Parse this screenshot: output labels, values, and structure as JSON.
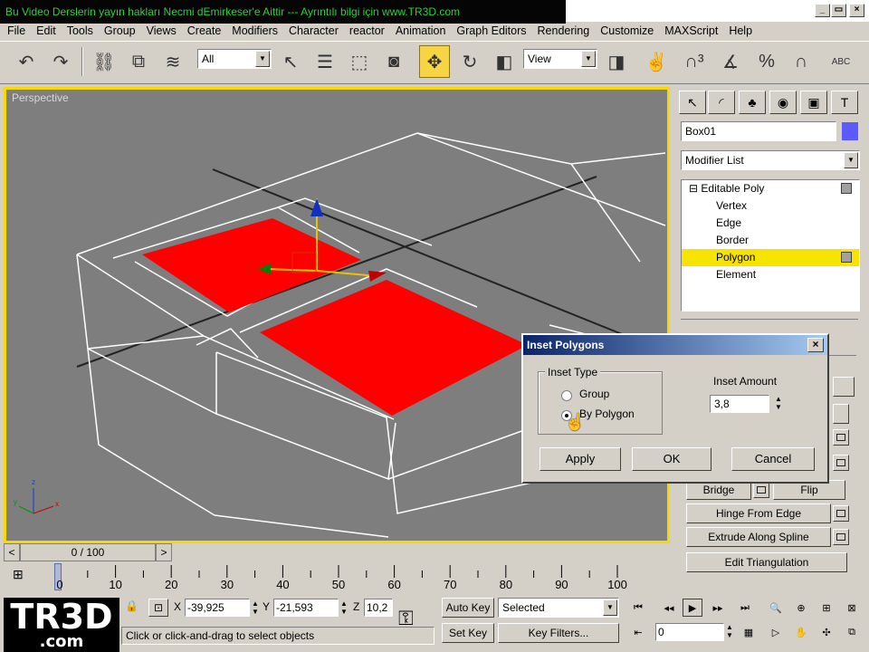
{
  "title_bar": {
    "text": "Bu Video Derslerin yayın hakları Necmi dEmirkeser'e Aittir --- Ayrıntılı bilgi için www.TR3D.com"
  },
  "menu": [
    "File",
    "Edit",
    "Tools",
    "Group",
    "Views",
    "Create",
    "Modifiers",
    "Character",
    "reactor",
    "Animation",
    "Graph Editors",
    "Rendering",
    "Customize",
    "MAXScript",
    "Help"
  ],
  "toolbar": {
    "selection_filter": "All",
    "ref_coord": "View",
    "abc_label": "ABC"
  },
  "viewport": {
    "label": "Perspective",
    "axis_labels": [
      "x",
      "y",
      "z"
    ],
    "accent_color": "#f5d900",
    "poly_color": "#ff0000"
  },
  "command_panel": {
    "object_name": "Box01",
    "object_color": "#5a5aff",
    "modifier_list": "Modifier List",
    "stack": [
      "Editable Poly",
      "Vertex",
      "Edge",
      "Border",
      "Polygon",
      "Element"
    ],
    "buttons": [
      "Bridge",
      "Flip",
      "Hinge From Edge",
      "Extrude Along Spline",
      "Edit Triangulation"
    ]
  },
  "dialog": {
    "title": "Inset Polygons",
    "group_label": "Inset Type",
    "options": [
      "Group",
      "By Polygon"
    ],
    "selected_option": "By Polygon",
    "amount_label": "Inset Amount",
    "amount_value": "3,8",
    "apply": "Apply",
    "ok": "OK",
    "cancel": "Cancel"
  },
  "timeline": {
    "frame_display": "0 / 100",
    "ticks": [
      "0",
      "10",
      "20",
      "30",
      "40",
      "50",
      "60",
      "70",
      "80",
      "90",
      "100"
    ]
  },
  "status": {
    "x_label": "X",
    "x_value": "-39,925",
    "y_label": "Y",
    "y_value": "-21,593",
    "z_label": "Z",
    "z_value": "10,2",
    "prompt": "Click or click-and-drag to select objects",
    "auto_key": "Auto Key",
    "set_key": "Set Key",
    "key_mode": "Selected",
    "key_filters": "Key Filters...",
    "current_frame": "0"
  },
  "logo": {
    "text": "TR3D",
    "sub": ".com"
  }
}
